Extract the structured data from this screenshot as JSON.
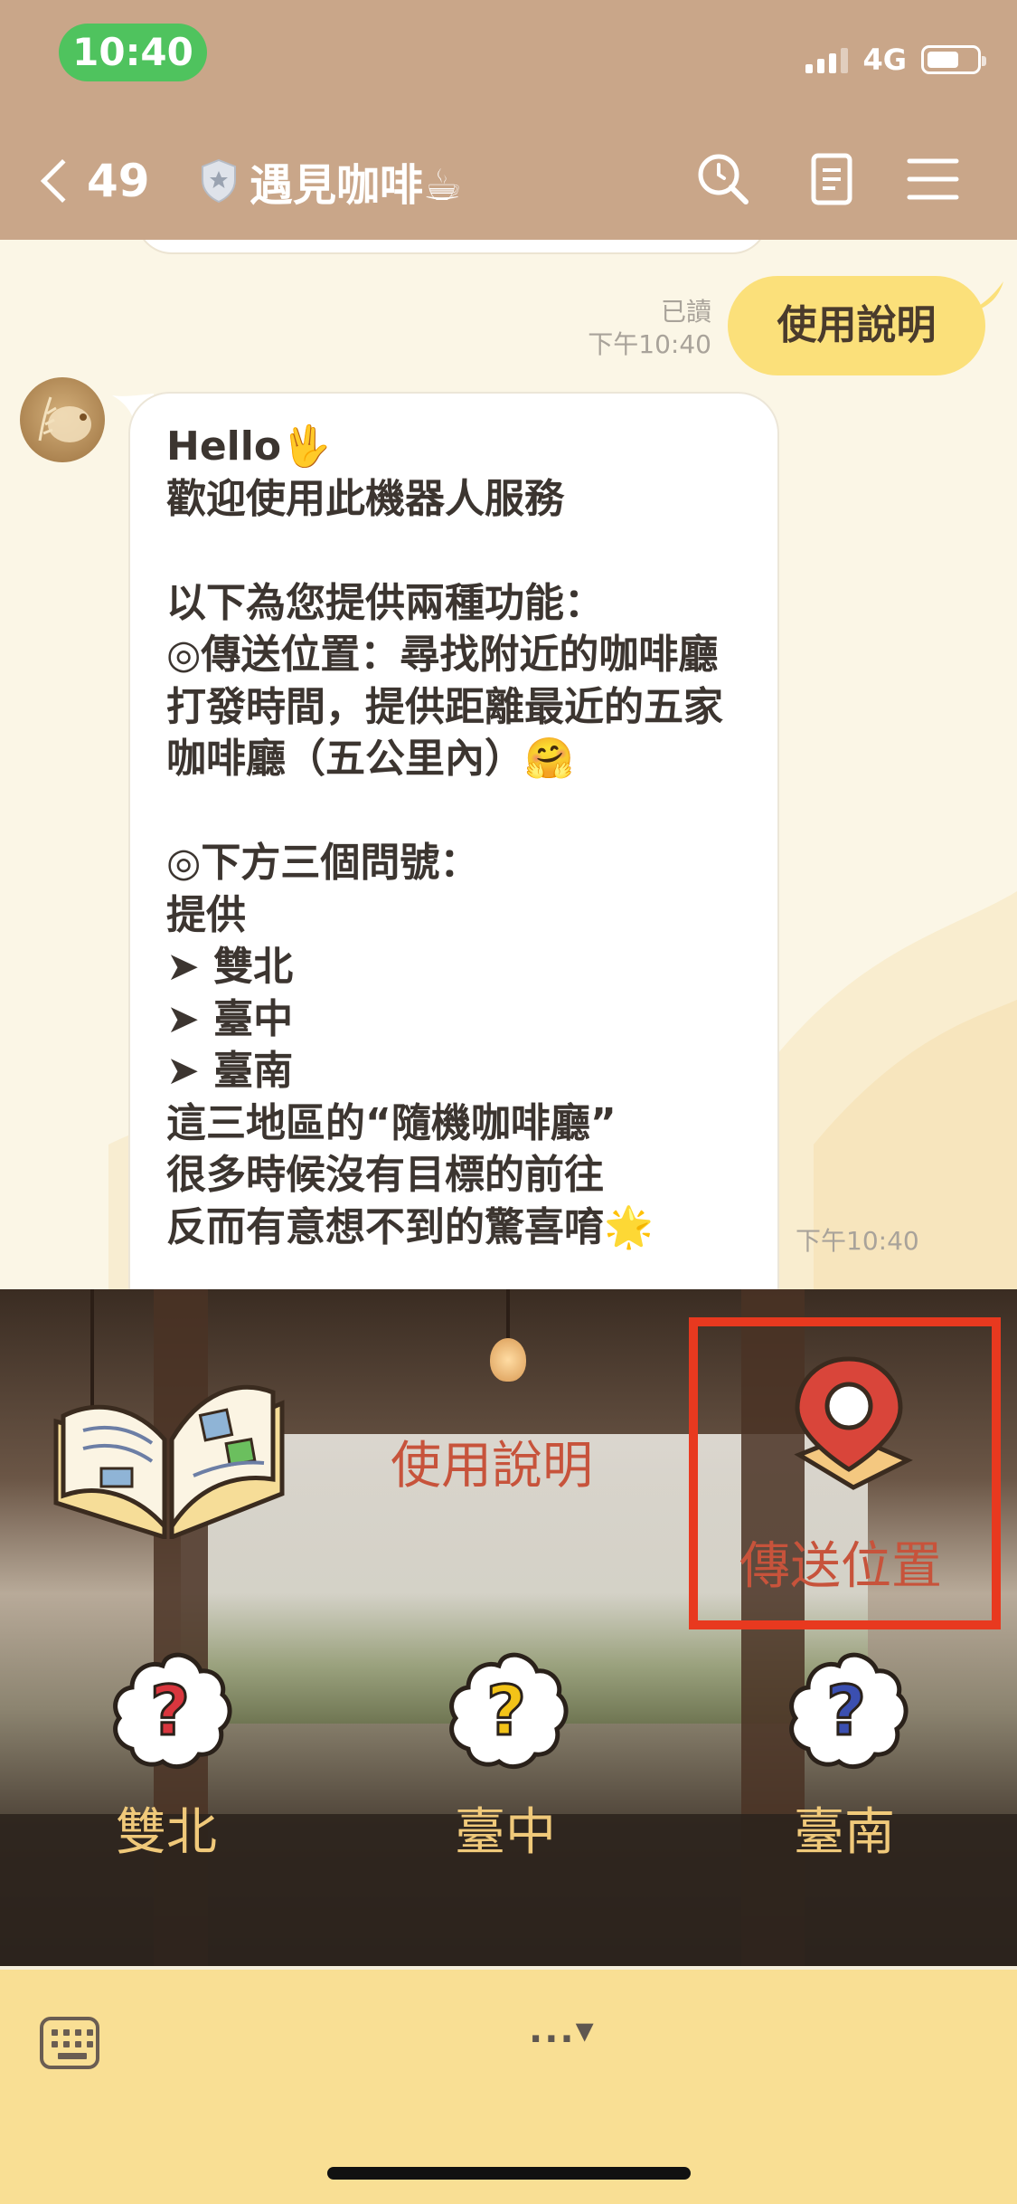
{
  "status_bar": {
    "time": "10:40",
    "network": "4G",
    "battery_level": 0.65
  },
  "header": {
    "back_count": "49",
    "title": "遇見咖啡☕"
  },
  "chat": {
    "user_message": {
      "text": "使用說明",
      "read": "已讀",
      "time": "下午10:40"
    },
    "bot_message": {
      "text": "Hello🖖\n歡迎使用此機器人服務\n\n以下為您提供兩種功能：\n◎傳送位置：尋找附近的咖啡廳打發時間，提供距離最近的五家咖啡廳（五公里內）🤗\n\n◎下方三個問號：\n提供\n➤ 雙北\n➤ 臺中\n➤ 臺南\n這三地區的“隨機咖啡廳”\n很多時候沒有目標的前往\n反而有意想不到的驚喜唷🌟",
      "time": "下午10:40"
    }
  },
  "rich_menu": {
    "guide_label": "使用說明",
    "location_label": "傳送位置",
    "regions": [
      {
        "label": "雙北",
        "color": "#d9363e"
      },
      {
        "label": "臺中",
        "color": "#f2c318"
      },
      {
        "label": "臺南",
        "color": "#3b4fb0"
      }
    ]
  },
  "input_bar": {
    "more_label": "...▾"
  }
}
